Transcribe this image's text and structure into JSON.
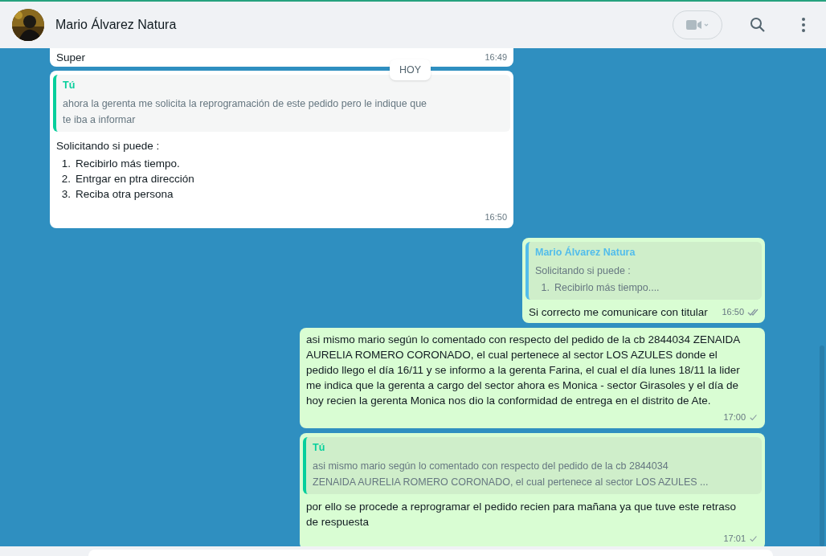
{
  "header": {
    "contact_name": "Mario Álvarez Natura"
  },
  "date_chip": "HOY",
  "messages": [
    {
      "outgoing": false,
      "blocks": [
        {
          "kind": "paragraph",
          "text": "Super"
        }
      ],
      "time": "16:49"
    },
    {
      "outgoing": false,
      "quote": {
        "author": "Tú",
        "color": "#06cf9c",
        "lines": [
          "ahora la gerenta me solicita la reprogramación de este pedido pero le indique que",
          "te iba a informar"
        ]
      },
      "blocks": [
        {
          "kind": "paragraph",
          "text": "Solicitando si puede :"
        },
        {
          "kind": "list",
          "items": [
            {
              "number": "1.",
              "text": "Recibirlo más tiempo."
            },
            {
              "number": "2.",
              "text": "Entrgar en ptra dirección"
            },
            {
              "number": "3.",
              "text": "Reciba otra persona"
            }
          ]
        }
      ],
      "time": "16:50"
    },
    {
      "outgoing": true,
      "quote": {
        "author": "Mario Álvarez Natura",
        "color": "#53bdeb",
        "lines": [
          "Solicitando si puede :"
        ],
        "list": [
          {
            "number": "1.",
            "text": "Recibirlo más tiempo...."
          }
        ]
      },
      "blocks": [
        {
          "kind": "paragraph",
          "text": "Si correcto me comunicare con titular"
        }
      ],
      "time": "16:50",
      "delivered": true
    },
    {
      "outgoing": true,
      "blocks": [
        {
          "kind": "paragraph",
          "text": "asi mismo mario según lo comentado con respecto del pedido de la cb 2844034 ZENAIDA AURELIA ROMERO CORONADO, el cual pertenece al sector LOS AZULES donde el pedido llego el día 16/11 y se informo a la gerenta Farina, el cual el día lunes 18/11 la lider me indica que la gerenta a cargo del sector ahora es Monica - sector Girasoles y el día de hoy recien la gerenta Monica nos dio la conformidad de entrega en el distrito de Ate."
        }
      ],
      "time": "17:00",
      "delivered": false
    },
    {
      "outgoing": true,
      "quote": {
        "author": "Tú",
        "color": "#06cf9c",
        "lines": [
          "asi mismo mario según lo comentado con respecto del pedido de la cb 2844034",
          "ZENAIDA AURELIA ROMERO CORONADO, el cual pertenece al sector LOS AZULES ..."
        ]
      },
      "blocks": [
        {
          "kind": "paragraph",
          "text": "por ello se procede a reprogramar el pedido recien para mañana ya que tuve este retraso de respuesta"
        }
      ],
      "time": "17:01",
      "delivered": false
    }
  ]
}
